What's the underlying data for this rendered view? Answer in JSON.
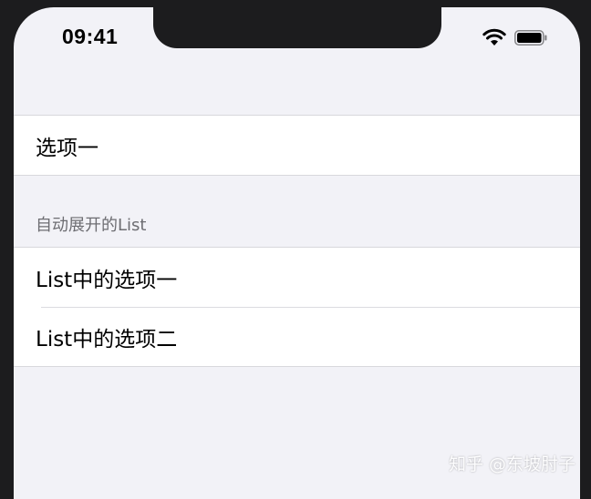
{
  "status_bar": {
    "time": "09:41"
  },
  "list": {
    "top_item": "选项一",
    "section_header": "自动展开的List",
    "section_items": [
      {
        "label": "List中的选项一"
      },
      {
        "label": "List中的选项二"
      }
    ]
  },
  "watermark": "知乎 @东坡肘子",
  "icons": {
    "wifi": "wifi-icon",
    "battery": "battery-icon"
  },
  "colors": {
    "background": "#f2f2f7",
    "cell": "#ffffff",
    "separator": "#d8d8dc",
    "header_text": "#6d6d72",
    "frame": "#1c1c1e"
  }
}
